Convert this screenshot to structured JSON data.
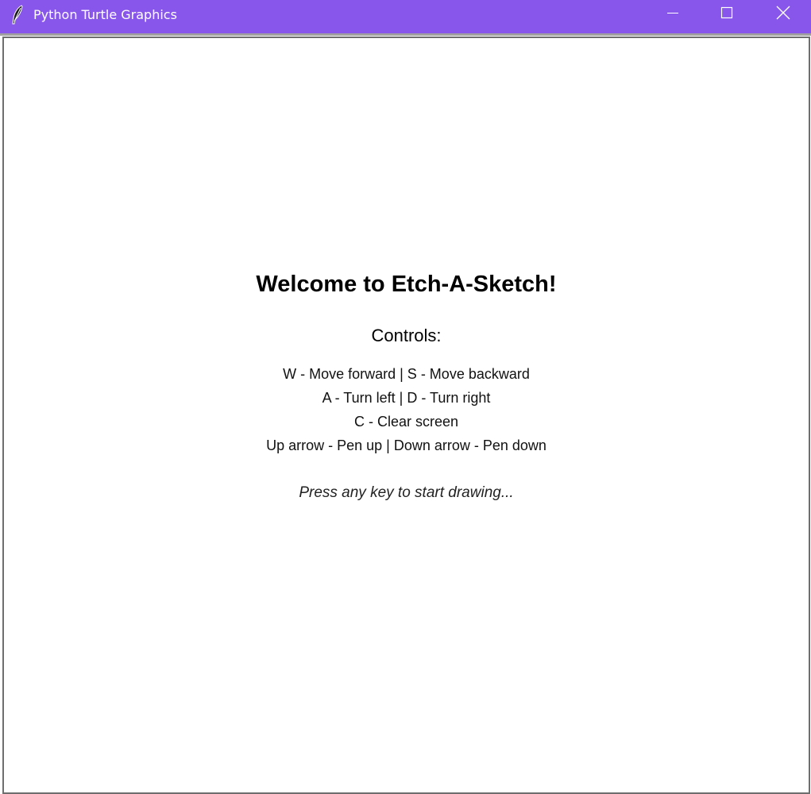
{
  "window": {
    "title": "Python Turtle Graphics",
    "app_icon": "feather-icon",
    "titlebar_color": "#8856ea",
    "controls": {
      "minimize": "minimize-icon",
      "maximize": "maximize-icon",
      "close": "close-icon"
    }
  },
  "canvas": {
    "background": "#ffffff",
    "welcome": "Welcome to Etch-A-Sketch!",
    "controls_heading": "Controls:",
    "lines": [
      "W - Move forward | S - Move backward",
      "A - Turn left | D - Turn right",
      "C - Clear screen",
      "Up arrow - Pen up | Down arrow - Pen down"
    ],
    "prompt": "Press any key to start drawing..."
  }
}
